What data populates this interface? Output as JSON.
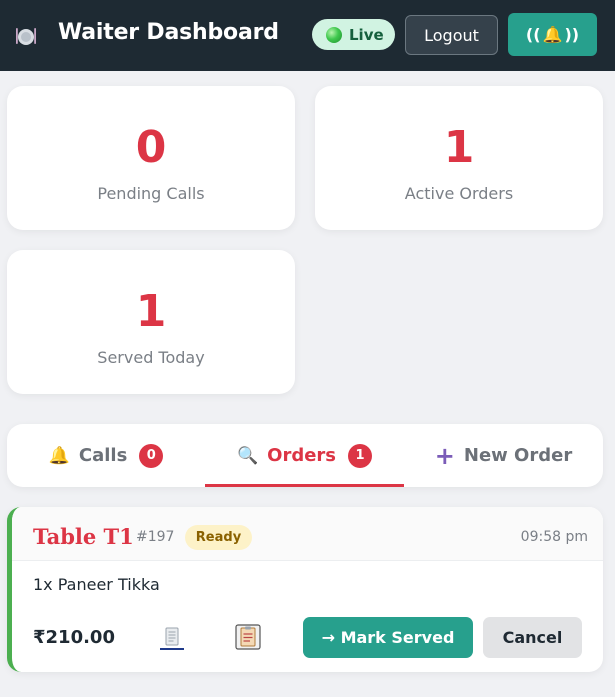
{
  "header": {
    "logo_icon": "plate-icon",
    "title": "Waiter Dashboard",
    "live_label": "Live",
    "logout_label": "Logout",
    "bell_label_left": "((",
    "bell_label_right": "))",
    "bell_icon": "bell-icon"
  },
  "stats": {
    "pending": {
      "value": "0",
      "label": "Pending Calls"
    },
    "active": {
      "value": "1",
      "label": "Active Orders"
    },
    "served": {
      "value": "1",
      "label": "Served Today"
    }
  },
  "tabs": [
    {
      "icon": "bell-icon",
      "icon_glyph": "🔔",
      "label": "Calls",
      "count": "0",
      "active": false
    },
    {
      "icon": "magnifier-icon",
      "icon_glyph": "🔍",
      "label": "Orders",
      "count": "1",
      "active": true
    },
    {
      "icon": "plus-icon",
      "icon_glyph": "+",
      "label": "New Order",
      "active": false
    }
  ],
  "order": {
    "table": "Table T1",
    "number": "#197",
    "status": "Ready",
    "time": "09:58 pm",
    "items": "1x Paneer Tikka",
    "total": "₹210.00",
    "serve_label": "→ Mark Served",
    "cancel_label": "Cancel"
  },
  "colors": {
    "header_bg": "#1e2a33",
    "accent_red": "#dc3545",
    "teal": "#27a08d",
    "ready_bg": "#fdf2c8",
    "live_bg": "#d1f3e2",
    "order_border": "#4caf50"
  }
}
